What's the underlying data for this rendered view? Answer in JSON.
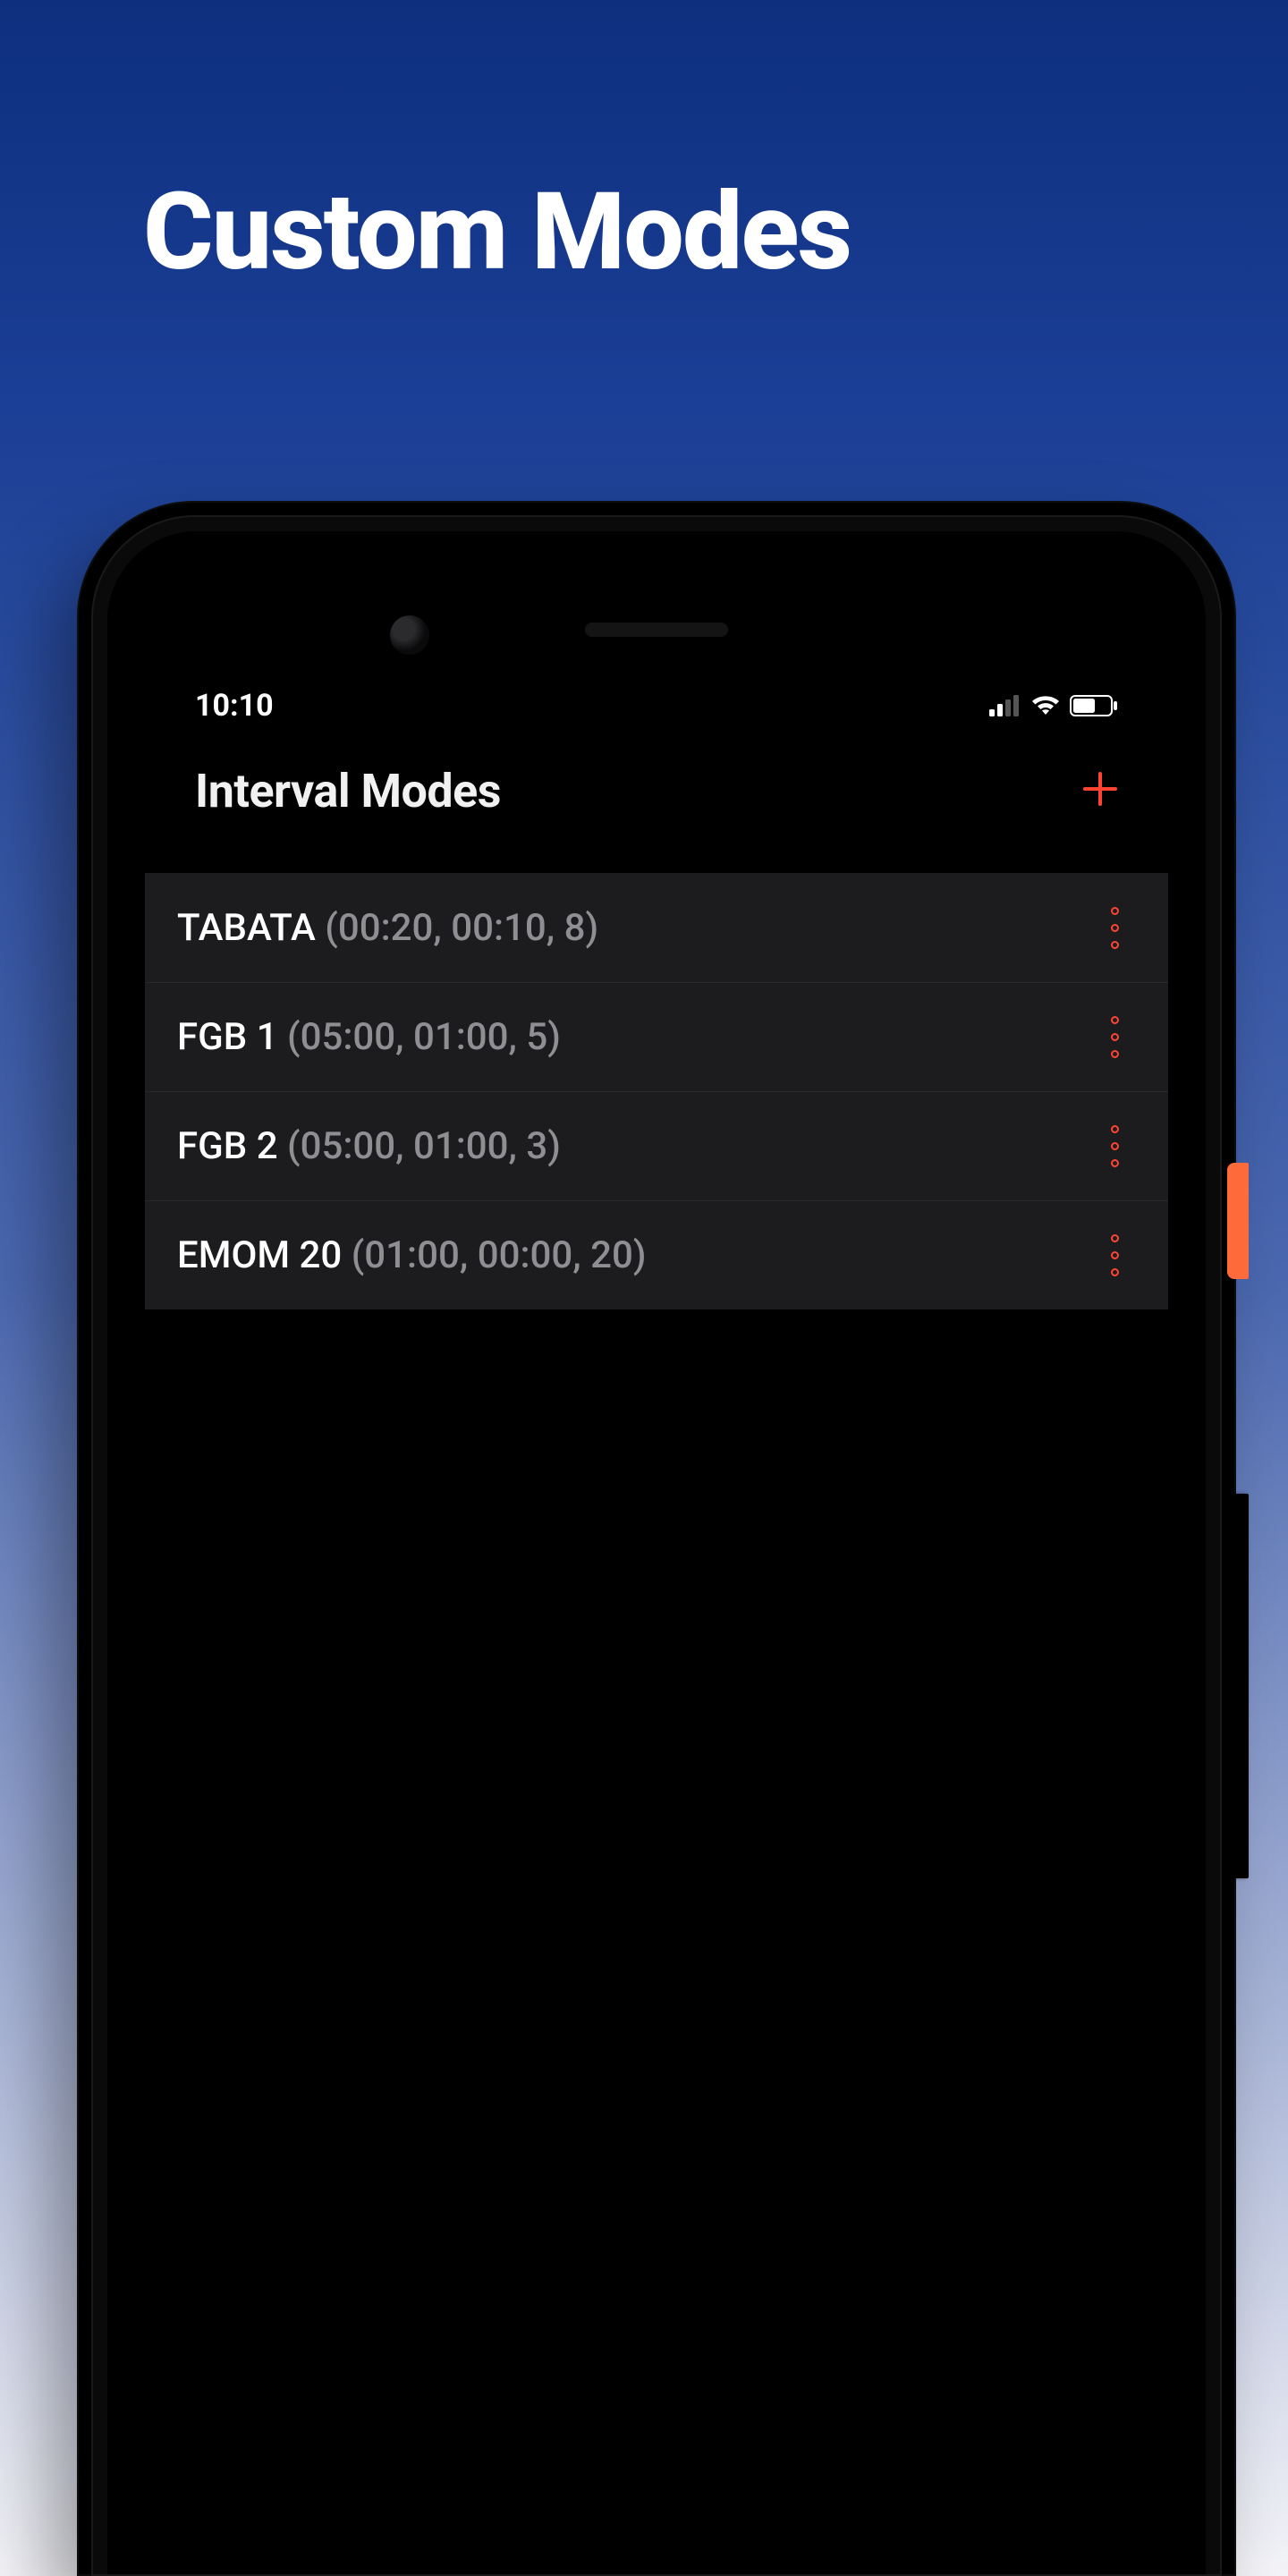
{
  "promo": {
    "title": "Custom Modes"
  },
  "status": {
    "time": "10:10"
  },
  "header": {
    "title": "Interval Modes"
  },
  "accent_color": "#ff4433",
  "modes": [
    {
      "name": "TABATA",
      "params": "(00:20, 00:10, 8)"
    },
    {
      "name": "FGB 1",
      "params": "(05:00, 01:00, 5)"
    },
    {
      "name": "FGB 2",
      "params": "(05:00, 01:00, 3)"
    },
    {
      "name": "EMOM 20",
      "params": "(01:00, 00:00, 20)"
    }
  ]
}
